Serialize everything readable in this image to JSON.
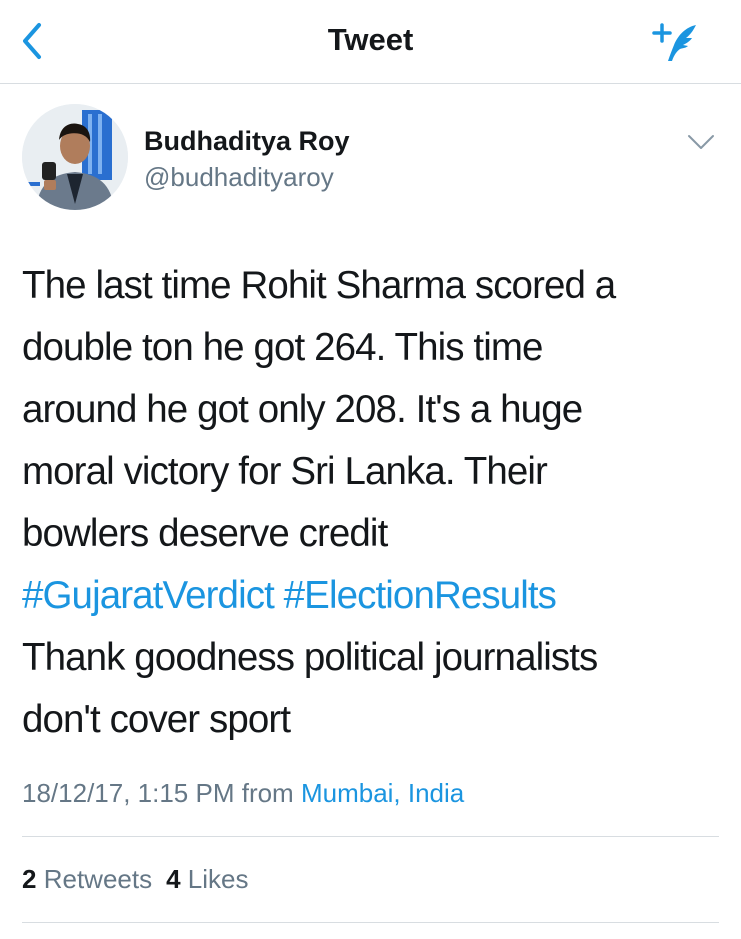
{
  "nav": {
    "title": "Tweet",
    "back_icon": "chevron-left-icon",
    "compose_icon": "compose-tweet-icon",
    "accent_color": "#1b95e0"
  },
  "author": {
    "name": "Budhaditya Roy",
    "handle": "@budhadityaroy",
    "menu_icon": "chevron-down-icon"
  },
  "tweet": {
    "lines": [
      "The last time Rohit Sharma scored a",
      "double ton he got 264. This time",
      "around he got only 208. It's a huge",
      "moral victory for Sri Lanka. Their",
      "bowlers deserve credit"
    ],
    "hashtags": [
      "#GujaratVerdict",
      "#ElectionResults"
    ],
    "closing_lines": [
      "Thank goodness political journalists",
      "don't cover sport"
    ]
  },
  "meta": {
    "timestamp": "18/12/17, 1:15 PM",
    "from_label": "from",
    "location": "Mumbai, India"
  },
  "stats": {
    "retweets_count": "2",
    "retweets_label": "Retweets",
    "likes_count": "4",
    "likes_label": "Likes"
  },
  "colors": {
    "text_primary": "#14171a",
    "text_secondary": "#657786",
    "link": "#1b95e0",
    "divider": "#d8dde1"
  }
}
